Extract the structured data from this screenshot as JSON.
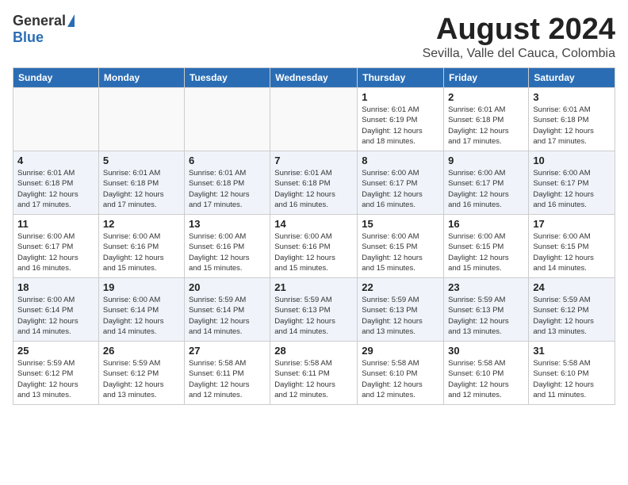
{
  "header": {
    "logo_general": "General",
    "logo_blue": "Blue",
    "title": "August 2024",
    "location": "Sevilla, Valle del Cauca, Colombia"
  },
  "weekdays": [
    "Sunday",
    "Monday",
    "Tuesday",
    "Wednesday",
    "Thursday",
    "Friday",
    "Saturday"
  ],
  "weeks": [
    [
      {
        "day": "",
        "info": ""
      },
      {
        "day": "",
        "info": ""
      },
      {
        "day": "",
        "info": ""
      },
      {
        "day": "",
        "info": ""
      },
      {
        "day": "1",
        "info": "Sunrise: 6:01 AM\nSunset: 6:19 PM\nDaylight: 12 hours\nand 18 minutes."
      },
      {
        "day": "2",
        "info": "Sunrise: 6:01 AM\nSunset: 6:18 PM\nDaylight: 12 hours\nand 17 minutes."
      },
      {
        "day": "3",
        "info": "Sunrise: 6:01 AM\nSunset: 6:18 PM\nDaylight: 12 hours\nand 17 minutes."
      }
    ],
    [
      {
        "day": "4",
        "info": "Sunrise: 6:01 AM\nSunset: 6:18 PM\nDaylight: 12 hours\nand 17 minutes."
      },
      {
        "day": "5",
        "info": "Sunrise: 6:01 AM\nSunset: 6:18 PM\nDaylight: 12 hours\nand 17 minutes."
      },
      {
        "day": "6",
        "info": "Sunrise: 6:01 AM\nSunset: 6:18 PM\nDaylight: 12 hours\nand 17 minutes."
      },
      {
        "day": "7",
        "info": "Sunrise: 6:01 AM\nSunset: 6:18 PM\nDaylight: 12 hours\nand 16 minutes."
      },
      {
        "day": "8",
        "info": "Sunrise: 6:00 AM\nSunset: 6:17 PM\nDaylight: 12 hours\nand 16 minutes."
      },
      {
        "day": "9",
        "info": "Sunrise: 6:00 AM\nSunset: 6:17 PM\nDaylight: 12 hours\nand 16 minutes."
      },
      {
        "day": "10",
        "info": "Sunrise: 6:00 AM\nSunset: 6:17 PM\nDaylight: 12 hours\nand 16 minutes."
      }
    ],
    [
      {
        "day": "11",
        "info": "Sunrise: 6:00 AM\nSunset: 6:17 PM\nDaylight: 12 hours\nand 16 minutes."
      },
      {
        "day": "12",
        "info": "Sunrise: 6:00 AM\nSunset: 6:16 PM\nDaylight: 12 hours\nand 15 minutes."
      },
      {
        "day": "13",
        "info": "Sunrise: 6:00 AM\nSunset: 6:16 PM\nDaylight: 12 hours\nand 15 minutes."
      },
      {
        "day": "14",
        "info": "Sunrise: 6:00 AM\nSunset: 6:16 PM\nDaylight: 12 hours\nand 15 minutes."
      },
      {
        "day": "15",
        "info": "Sunrise: 6:00 AM\nSunset: 6:15 PM\nDaylight: 12 hours\nand 15 minutes."
      },
      {
        "day": "16",
        "info": "Sunrise: 6:00 AM\nSunset: 6:15 PM\nDaylight: 12 hours\nand 15 minutes."
      },
      {
        "day": "17",
        "info": "Sunrise: 6:00 AM\nSunset: 6:15 PM\nDaylight: 12 hours\nand 14 minutes."
      }
    ],
    [
      {
        "day": "18",
        "info": "Sunrise: 6:00 AM\nSunset: 6:14 PM\nDaylight: 12 hours\nand 14 minutes."
      },
      {
        "day": "19",
        "info": "Sunrise: 6:00 AM\nSunset: 6:14 PM\nDaylight: 12 hours\nand 14 minutes."
      },
      {
        "day": "20",
        "info": "Sunrise: 5:59 AM\nSunset: 6:14 PM\nDaylight: 12 hours\nand 14 minutes."
      },
      {
        "day": "21",
        "info": "Sunrise: 5:59 AM\nSunset: 6:13 PM\nDaylight: 12 hours\nand 14 minutes."
      },
      {
        "day": "22",
        "info": "Sunrise: 5:59 AM\nSunset: 6:13 PM\nDaylight: 12 hours\nand 13 minutes."
      },
      {
        "day": "23",
        "info": "Sunrise: 5:59 AM\nSunset: 6:13 PM\nDaylight: 12 hours\nand 13 minutes."
      },
      {
        "day": "24",
        "info": "Sunrise: 5:59 AM\nSunset: 6:12 PM\nDaylight: 12 hours\nand 13 minutes."
      }
    ],
    [
      {
        "day": "25",
        "info": "Sunrise: 5:59 AM\nSunset: 6:12 PM\nDaylight: 12 hours\nand 13 minutes."
      },
      {
        "day": "26",
        "info": "Sunrise: 5:59 AM\nSunset: 6:12 PM\nDaylight: 12 hours\nand 13 minutes."
      },
      {
        "day": "27",
        "info": "Sunrise: 5:58 AM\nSunset: 6:11 PM\nDaylight: 12 hours\nand 12 minutes."
      },
      {
        "day": "28",
        "info": "Sunrise: 5:58 AM\nSunset: 6:11 PM\nDaylight: 12 hours\nand 12 minutes."
      },
      {
        "day": "29",
        "info": "Sunrise: 5:58 AM\nSunset: 6:10 PM\nDaylight: 12 hours\nand 12 minutes."
      },
      {
        "day": "30",
        "info": "Sunrise: 5:58 AM\nSunset: 6:10 PM\nDaylight: 12 hours\nand 12 minutes."
      },
      {
        "day": "31",
        "info": "Sunrise: 5:58 AM\nSunset: 6:10 PM\nDaylight: 12 hours\nand 11 minutes."
      }
    ]
  ]
}
